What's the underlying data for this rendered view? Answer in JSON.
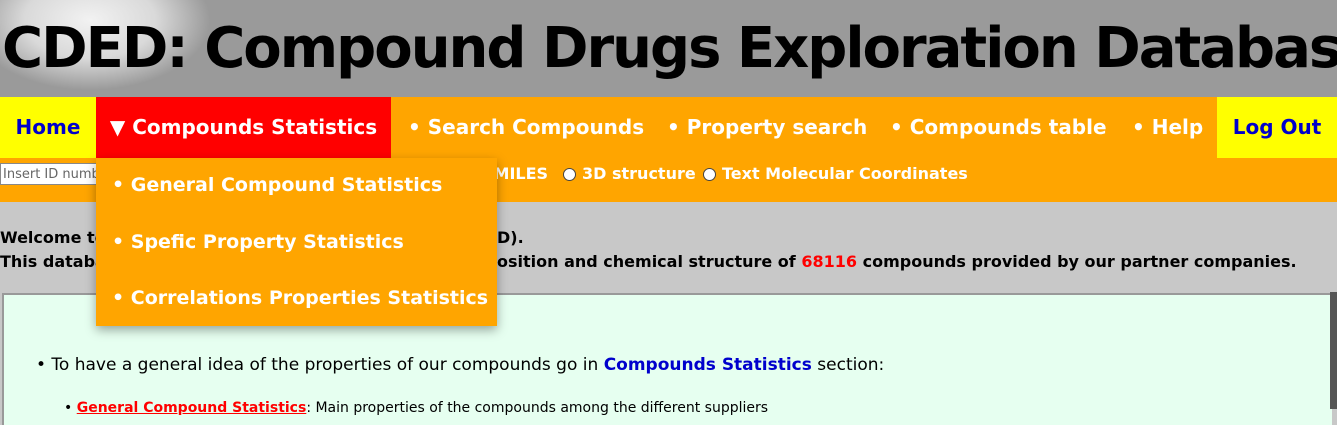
{
  "header": {
    "title": "CDED: Compound Drugs Exploration Database"
  },
  "nav": {
    "home": "Home",
    "stats": "▼ Compounds Statistics",
    "search": "• Search Compounds",
    "property": "• Property search",
    "table": "• Compounds table",
    "help": "• Help",
    "logout": "Log Out"
  },
  "dropdown": {
    "items": [
      "• General Compound Statistics",
      "• Spefic Property Statistics",
      "• Correlations Properties Statistics"
    ]
  },
  "search": {
    "placeholder": "Insert ID number",
    "options": [
      "SMILES",
      "3D structure",
      "Text Molecular Coordinates"
    ]
  },
  "welcome": {
    "line1_start": "Welcome to",
    "line1_end": "D).",
    "line2_start": "This databa",
    "line2_mid": "osition and chemical structure of",
    "count": "68116",
    "line2_end": "compounds provided by our partner companies."
  },
  "content": {
    "bullet1_pre": "• To have a general idea of the properties of our compounds go in",
    "bullet1_link": "Compounds Statistics",
    "bullet1_post": "section:",
    "sub1_link": "General Compound Statistics",
    "sub1_text": ": Main properties of the compounds among the different suppliers"
  },
  "colors": {
    "nav_bg": "#ffa500",
    "home_bg": "#ffff00",
    "active_bg": "#ff0000",
    "link_blue": "#0000cc",
    "content_bg": "#e6fff0"
  }
}
